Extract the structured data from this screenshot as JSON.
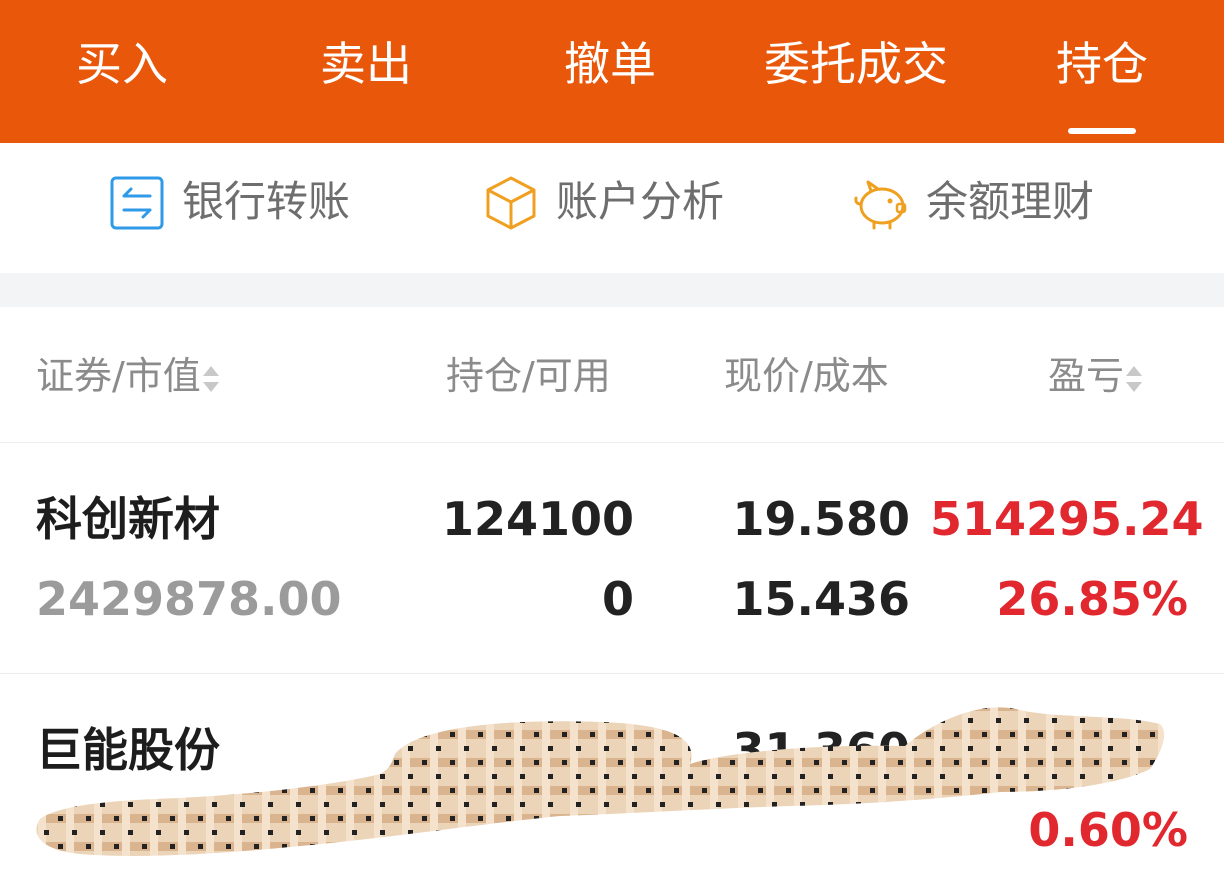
{
  "tabs": [
    {
      "label": "买入"
    },
    {
      "label": "卖出"
    },
    {
      "label": "撤单"
    },
    {
      "label": "委托成交"
    },
    {
      "label": "持仓",
      "active": true
    }
  ],
  "actions": [
    {
      "label": "银行转账",
      "icon": "bank-transfer-icon"
    },
    {
      "label": "账户分析",
      "icon": "cube-icon"
    },
    {
      "label": "余额理财",
      "icon": "piggy-bank-icon"
    }
  ],
  "table_header": {
    "security": "证券/市值",
    "position": "持仓/可用",
    "price": "现价/成本",
    "pnl": "盈亏"
  },
  "holdings": [
    {
      "name": "科创新材",
      "market_value": "2429878.00",
      "position": "124100",
      "available": "0",
      "price": "19.580",
      "cost": "15.436",
      "pnl": "514295.24",
      "pnl_pct": "26.85%"
    },
    {
      "name": "巨能股份",
      "price": "31.360",
      "pnl_pct": "0.60%"
    }
  ],
  "colors": {
    "brand": "#e9570a",
    "gain": "#e0282e",
    "transfer_icon": "#2f9be8",
    "analysis_icon": "#f0a020",
    "piggy_icon": "#f0a020"
  }
}
